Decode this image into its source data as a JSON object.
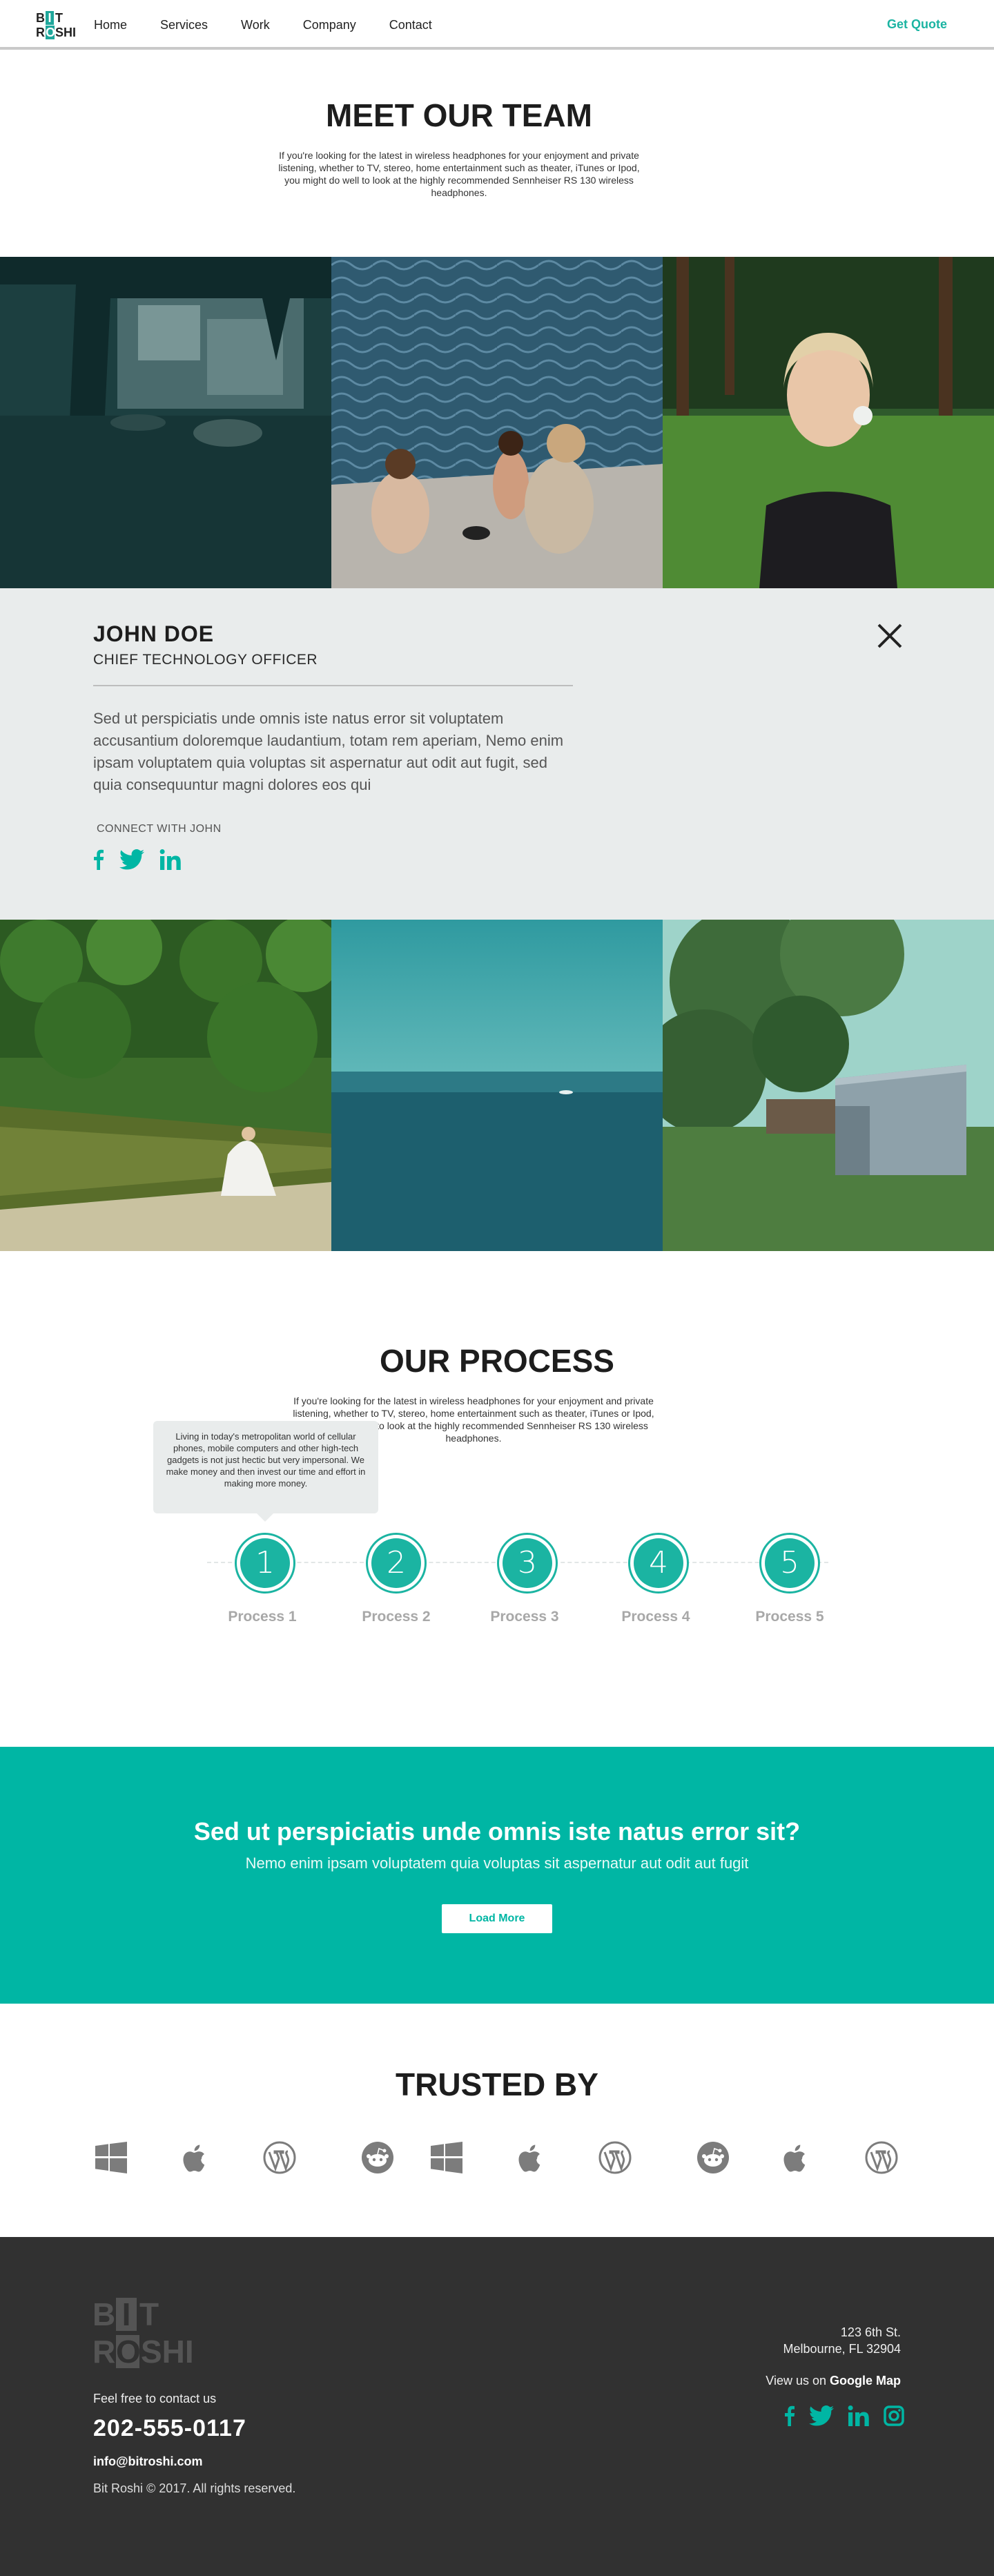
{
  "nav": {
    "logo_row1": [
      "B",
      "I",
      "T"
    ],
    "logo_row2": [
      "R",
      "O",
      "SHI"
    ],
    "links": [
      "Home",
      "Services",
      "Work",
      "Company",
      "Contact"
    ],
    "cta": "Get Quote"
  },
  "team": {
    "title": "MEET OUR TEAM",
    "subtitle": "If you're looking for the latest in wireless headphones for your enjoyment and private listening, whether to TV, stereo, home entertainment such as theater, iTunes or Ipod, you might do well to look at the highly recommended Sennheiser RS 130 wireless headphones."
  },
  "profile": {
    "name": "JOHN DOE",
    "role": "CHIEF TECHNOLOGY OFFICER",
    "bio": "Sed ut perspiciatis unde omnis iste natus error sit voluptatem accusantium doloremque laudantium, totam rem aperiam, Nemo enim ipsam voluptatem quia voluptas sit aspernatur aut odit aut fugit, sed quia consequuntur magni dolores eos qui",
    "connect": "CONNECT WITH JOHN",
    "social_icons": [
      "facebook-icon",
      "twitter-icon",
      "linkedin-icon"
    ]
  },
  "process": {
    "title": "OUR PROCESS",
    "subtitle": "If you're looking for the latest in wireless headphones for your enjoyment and private listening, whether to TV, stereo, home entertainment such as theater, iTunes or Ipod, you might do well to look at the highly recommended Sennheiser RS 130 wireless headphones.",
    "tooltip": "Living in today's metropolitan world of cellular phones, mobile computers and other high-tech gadgets is not just hectic but very impersonal. We make money and then invest our time and effort in making more money.",
    "steps": [
      {
        "num": "1",
        "label": "Process 1"
      },
      {
        "num": "2",
        "label": "Process 2"
      },
      {
        "num": "3",
        "label": "Process 3"
      },
      {
        "num": "4",
        "label": "Process 4"
      },
      {
        "num": "5",
        "label": "Process 5"
      }
    ]
  },
  "cta": {
    "heading": "Sed ut perspiciatis unde omnis iste natus error sit?",
    "sub": "Nemo enim ipsam voluptatem quia voluptas sit aspernatur aut odit aut fugit",
    "button": "Load More"
  },
  "trusted": {
    "title": "TRUSTED BY",
    "logos": [
      "windows-icon",
      "apple-icon",
      "wordpress-icon",
      "reddit-icon",
      "windows-icon",
      "apple-icon",
      "wordpress-icon",
      "reddit-icon",
      "apple-icon",
      "wordpress-icon"
    ]
  },
  "footer": {
    "logo_row1": [
      "B",
      "I",
      "T"
    ],
    "logo_row2": [
      "R",
      "O",
      "SHI"
    ],
    "contact_label": "Feel free to contact us",
    "phone": "202-555-0117",
    "email": "info@bitroshi.com",
    "copyright": "Bit Roshi © 2017. All rights reserved.",
    "address_line1": "123 6th St.",
    "address_line2": "Melbourne, FL 32904",
    "map_prefix": "View us on ",
    "map_link": "Google Map",
    "social_icons": [
      "facebook-icon",
      "twitter-icon",
      "linkedin-icon",
      "instagram-icon"
    ]
  },
  "colors": {
    "accent": "#00b6a4",
    "footer_bg": "#313131",
    "profile_bg": "#e9ecec"
  }
}
